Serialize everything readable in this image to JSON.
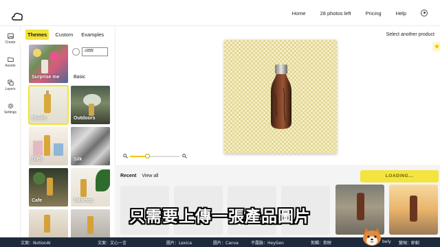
{
  "topnav": {
    "logo": "cloud-logo",
    "items": [
      {
        "label": "Home"
      },
      {
        "label": "28 photos left"
      },
      {
        "label": "Pricing"
      },
      {
        "label": "Help"
      }
    ]
  },
  "rail": {
    "items": [
      {
        "label": "Create",
        "icon": "image-icon"
      },
      {
        "label": "Assets",
        "icon": "folder-icon"
      },
      {
        "label": "Layers",
        "icon": "layers-icon"
      },
      {
        "label": "Settings",
        "icon": "gear-icon"
      }
    ]
  },
  "panel": {
    "tabs": [
      {
        "label": "Themes",
        "active": true
      },
      {
        "label": "Custom",
        "active": false
      },
      {
        "label": "Examples",
        "active": false
      }
    ],
    "basic": {
      "hex_value": "#ffffff",
      "label": "Basic"
    },
    "themes": [
      {
        "label": "Surprise me"
      },
      {
        "label": "Studio",
        "selected": true
      },
      {
        "label": "Outdoors"
      },
      {
        "label": "Gifts"
      },
      {
        "label": "Silk"
      },
      {
        "label": "Cafe"
      },
      {
        "label": "Tabletop"
      }
    ]
  },
  "stage": {
    "select_another": "Select another product",
    "zoom_level": 0.35
  },
  "recent": {
    "tabs": [
      {
        "label": "Recent",
        "active": true
      },
      {
        "label": "View all",
        "active": false
      }
    ],
    "loading_label": "LOADING..."
  },
  "subtitle": "只需要上傳一張產品圖片",
  "credits": [
    {
      "role": "文案",
      "value": "NotionAI"
    },
    {
      "role": "文案",
      "value": "文心一言"
    },
    {
      "role": "圖片",
      "value": "Lexica"
    },
    {
      "role": "圖片",
      "value": "Canva"
    },
    {
      "role": "不露臉",
      "value": "HeyGen"
    },
    {
      "role": "剪輯",
      "value": "剪映"
    },
    {
      "role": "",
      "value": "bely"
    },
    {
      "role": "變現",
      "value": "即創"
    }
  ],
  "colors": {
    "accent": "#f2e33a",
    "ticker_bg": "#1d2a3b"
  }
}
